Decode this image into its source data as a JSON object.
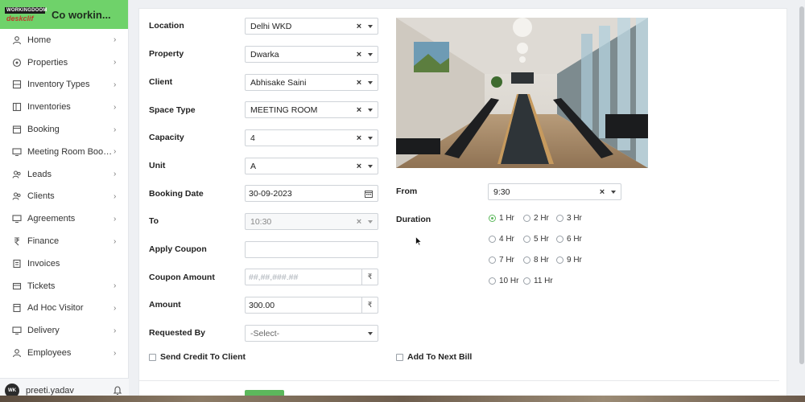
{
  "brand": {
    "logo_top": "WORKINGDOOM",
    "logo_bottom": "deskclif",
    "title": "Co workin..."
  },
  "sidebar": {
    "items": [
      {
        "label": "Home",
        "icon": "home-icon",
        "chevron": true
      },
      {
        "label": "Properties",
        "icon": "properties-icon",
        "chevron": true
      },
      {
        "label": "Inventory Types",
        "icon": "inventory-types-icon",
        "chevron": true
      },
      {
        "label": "Inventories",
        "icon": "inventories-icon",
        "chevron": true
      },
      {
        "label": "Booking",
        "icon": "booking-icon",
        "chevron": true
      },
      {
        "label": "Meeting Room Book...",
        "icon": "monitor-icon",
        "chevron": true
      },
      {
        "label": "Leads",
        "icon": "leads-icon",
        "chevron": true
      },
      {
        "label": "Clients",
        "icon": "clients-icon",
        "chevron": true
      },
      {
        "label": "Agreements",
        "icon": "agreements-icon",
        "chevron": true
      },
      {
        "label": "Finance",
        "icon": "finance-icon",
        "chevron": true
      },
      {
        "label": "Invoices",
        "icon": "invoices-icon",
        "chevron": false
      },
      {
        "label": "Tickets",
        "icon": "tickets-icon",
        "chevron": true
      },
      {
        "label": "Ad Hoc Visitor",
        "icon": "visitor-icon",
        "chevron": true
      },
      {
        "label": "Delivery",
        "icon": "delivery-icon",
        "chevron": true
      },
      {
        "label": "Employees",
        "icon": "employees-icon",
        "chevron": true
      }
    ]
  },
  "user": {
    "initials": "WK",
    "name": "preeti.yadav"
  },
  "form": {
    "location": {
      "label": "Location",
      "value": "Delhi WKD"
    },
    "property": {
      "label": "Property",
      "value": "Dwarka"
    },
    "client": {
      "label": "Client",
      "value": "Abhisake Saini"
    },
    "space_type": {
      "label": "Space Type",
      "value": "MEETING ROOM"
    },
    "capacity": {
      "label": "Capacity",
      "value": "4"
    },
    "unit": {
      "label": "Unit",
      "value": "A"
    },
    "booking_date": {
      "label": "Booking Date",
      "value": "30-09-2023"
    },
    "to": {
      "label": "To",
      "value": "10:30"
    },
    "apply_coupon": {
      "label": "Apply Coupon",
      "value": ""
    },
    "coupon_amount": {
      "label": "Coupon Amount",
      "placeholder": "##,##,###.##",
      "currency": "₹"
    },
    "amount": {
      "label": "Amount",
      "value": "300.00",
      "currency": "₹"
    },
    "requested_by": {
      "label": "Requested By",
      "value": "-Select-"
    },
    "send_credit": {
      "label": "Send Credit To Client",
      "checked": false
    },
    "from": {
      "label": "From",
      "value": "9:30"
    },
    "duration": {
      "label": "Duration",
      "selected": "1 Hr",
      "options": [
        "1 Hr",
        "2 Hr",
        "3 Hr",
        "4 Hr",
        "5 Hr",
        "6 Hr",
        "7 Hr",
        "8 Hr",
        "9 Hr",
        "10 Hr",
        "11 Hr"
      ]
    },
    "add_to_next_bill": {
      "label": "Add To Next Bill",
      "checked": false
    }
  },
  "colors": {
    "brand_green": "#6fd26a",
    "accent_green": "#5cb85c"
  }
}
